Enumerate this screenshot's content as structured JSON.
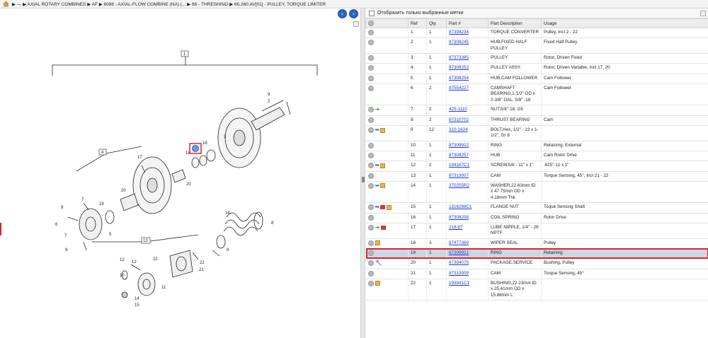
{
  "breadcrumb": {
    "home_icon": "home-icon",
    "text": "▶ ---  ▶ AXIAL ROTARY COMBINES  ▶ AF  ▶ 6088 - AXIAL-FLOW COMBINE (NA) (...  ▶ 66 - THRESHING  ▶ 66.260.AV[01] - PULLEY, TORQUE LIMITER"
  },
  "nav": {
    "back": "‹",
    "forward": "›"
  },
  "filter": {
    "label": "Отобразить только выбранные метки"
  },
  "table": {
    "headers": {
      "ref": "Ref",
      "qty": "Qty",
      "part": "Part #",
      "desc": "Part Description",
      "usage": "Usage"
    },
    "rows": [
      {
        "ref": "1",
        "qty": "1",
        "part": "87394234",
        "desc": "TORQUE CONVERTER",
        "usage": "Pulley, Incl 2 - 22",
        "icons": []
      },
      {
        "ref": "2",
        "qty": "1",
        "part": "87308245",
        "desc": "HUB,FIXED HALF PULLEY",
        "usage": "Fixed Half Pulley",
        "icons": []
      },
      {
        "ref": "3",
        "qty": "1",
        "part": "87373385",
        "desc": "PULLEY",
        "usage": "Rotor, Driven Fixed",
        "icons": []
      },
      {
        "ref": "4",
        "qty": "1",
        "part": "87308253",
        "desc": "PULLEY ASSY.",
        "usage": "Rotor, Driven Variable, Incl 17, 20",
        "icons": []
      },
      {
        "ref": "5",
        "qty": "1",
        "part": "87308254",
        "desc": "HUB,CAM FOLLOWER",
        "usage": "Cam Follower",
        "icons": []
      },
      {
        "ref": "6",
        "qty": "2",
        "part": "87554227",
        "desc": "CAMSHAFT BEARING,1-1/2\" OD x 2-3/8\" OAL, 5/8\" -18",
        "usage": "Cam Follower",
        "icons": []
      },
      {
        "ref": "7",
        "qty": "2",
        "part": "425-1110",
        "desc": "NUT,5/8\"-18, G5",
        "usage": "",
        "icons": [
          "arrow"
        ]
      },
      {
        "ref": "8",
        "qty": "2",
        "part": "87310702",
        "desc": "THRUST BEARING",
        "usage": "Cam",
        "icons": []
      },
      {
        "ref": "9",
        "qty": "12",
        "part": "310-1624",
        "desc": "BOLT,Hex, 1/2\" - 13 x 1-1/2\", Gr 8",
        "usage": "",
        "icons": [
          "blue",
          "box"
        ]
      },
      {
        "ref": "10",
        "qty": "1",
        "part": "87309922",
        "desc": "RING",
        "usage": "Retaining, External",
        "icons": []
      },
      {
        "ref": "11",
        "qty": "1",
        "part": "87308257",
        "desc": "HUB",
        "usage": "Cam Rotor Drive",
        "icons": []
      },
      {
        "ref": "12",
        "qty": "2",
        "part": "194167C1",
        "desc": "SCREW,5/8 - 11\" x 1\"",
        "usage": ".625\"-11 x 1\"",
        "icons": [
          "blue",
          "box"
        ]
      },
      {
        "ref": "13",
        "qty": "1",
        "part": "87313007",
        "desc": "CAM",
        "usage": "Torque Sensing, 45°, Incl 21 - 22",
        "icons": []
      },
      {
        "ref": "14",
        "qty": "1",
        "part": "370255R2",
        "desc": "WASHER,22.63mm ID x 47.75mm OD x 4.18mm Thk",
        "usage": "",
        "icons": [
          "blue",
          "box"
        ]
      },
      {
        "ref": "15",
        "qty": "1",
        "part": "1316288C1",
        "desc": "FLANGE NUT",
        "usage": "Toque Sensing Shaft",
        "icons": [
          "blue",
          "red",
          "box"
        ]
      },
      {
        "ref": "16",
        "qty": "1",
        "part": "87308258",
        "desc": "COIL SPRING",
        "usage": "Rotor Drive",
        "icons": []
      },
      {
        "ref": "17",
        "qty": "1",
        "part": "219-87",
        "desc": "LUBE NIPPLE, 1/4\" - 28 NPTF",
        "usage": "",
        "icons": [
          "arrow",
          "red"
        ]
      },
      {
        "ref": "18",
        "qty": "3",
        "part": "87477369",
        "desc": "WIPER SEAL",
        "usage": "Pulley",
        "icons": [
          "box"
        ]
      },
      {
        "ref": "19",
        "qty": "1",
        "part": "87309921",
        "desc": "RING",
        "usage": "Retaining",
        "icons": [],
        "selected": true
      },
      {
        "ref": "20",
        "qty": "1",
        "part": "87394075",
        "desc": "PACKAGE,SERVICE",
        "usage": "Bushing, Pulley",
        "icons": [
          "wrench"
        ]
      },
      {
        "ref": "21",
        "qty": "1",
        "part": "87313009",
        "desc": "CAM",
        "usage": "Torque Sensing, 45°",
        "icons": []
      },
      {
        "ref": "22",
        "qty": "1",
        "part": "193941C1",
        "desc": "BUSHING,22.23mm ID x 25.41mm OD x 15.88mm L",
        "usage": "",
        "icons": [
          "box"
        ]
      }
    ]
  },
  "diagram": {
    "callouts": [
      "1",
      "2",
      "3",
      "4",
      "5",
      "6",
      "7",
      "8",
      "9",
      "10",
      "11",
      "12",
      "13",
      "14",
      "15",
      "16",
      "17",
      "18",
      "19",
      "20",
      "21",
      "22"
    ],
    "boxed": [
      "1",
      "4",
      "13"
    ]
  }
}
